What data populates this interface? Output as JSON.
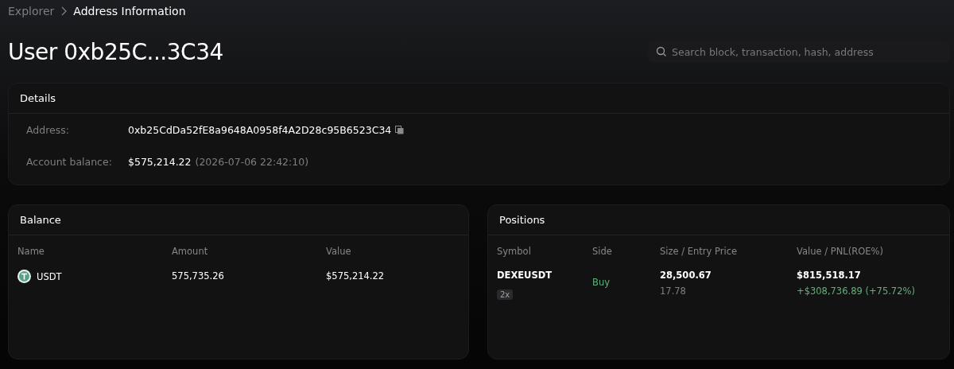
{
  "breadcrumb": [
    {
      "label": "Explorer"
    },
    {
      "label": "Address Information"
    }
  ],
  "title": "User 0xb25C...3C34",
  "search": {
    "placeholder": "Search block, transaction, hash, address"
  },
  "details": {
    "title": "Details",
    "rows": [
      {
        "label": "Address:",
        "value": "0xb25CdDa52fE8a9648A0958f4A2D28c95B6523C34",
        "kind": "copyable"
      },
      {
        "label": "Account balance:",
        "value": "$575,214.22",
        "note": "(2026-07-06 22:42:10)",
        "kind": "plain"
      }
    ]
  },
  "balance": {
    "title": "Balance",
    "columns": [
      "Name",
      "Amount",
      "Value"
    ],
    "rows": [
      {
        "name": "USDT",
        "amount": "575,735.26",
        "value": "$575,214.22"
      }
    ]
  },
  "positions": {
    "title": "Positions",
    "columns": [
      "Symbol",
      "Side",
      "Size / Entry Price",
      "Value / PNL(ROE%)"
    ],
    "rows": [
      {
        "symbol": "DEXEUSDT",
        "leverage": "2x",
        "side": "Buy",
        "size": "28,500.67",
        "entry_price": "17.78",
        "value": "$815,518.17",
        "pnl": "+$308,736.89 (+75.72%)"
      }
    ]
  }
}
